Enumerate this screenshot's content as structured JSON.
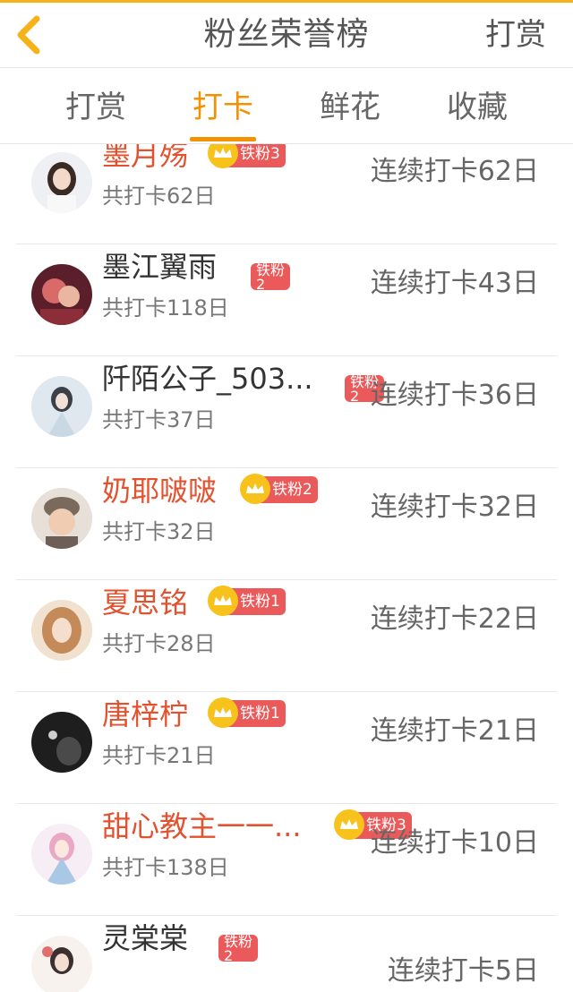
{
  "header": {
    "title": "粉丝荣誉榜",
    "reward_label": "打赏"
  },
  "tabs": [
    {
      "label": "打赏",
      "active": false
    },
    {
      "label": "打卡",
      "active": true
    },
    {
      "label": "鲜花",
      "active": false
    },
    {
      "label": "收藏",
      "active": false
    }
  ],
  "colors": {
    "accent": "#f29200",
    "vip_name": "#e2522f",
    "badge": "#ea5a5a",
    "crown": "#f6c21b"
  },
  "rows": [
    {
      "name": "墨月殇",
      "vip": true,
      "badge": "铁粉3",
      "total": "共打卡62日",
      "streak": "连续打卡62日"
    },
    {
      "name": "墨江翼雨",
      "vip": false,
      "badge": "铁粉\n2",
      "total": "共打卡118日",
      "streak": "连续打卡43日"
    },
    {
      "name": "阡陌公子_503...",
      "vip": false,
      "badge": "铁粉\n2",
      "total": "共打卡37日",
      "streak": "连续打卡36日"
    },
    {
      "name": "奶耶啵啵",
      "vip": true,
      "badge": "铁粉2",
      "total": "共打卡32日",
      "streak": "连续打卡32日"
    },
    {
      "name": "夏思铭",
      "vip": true,
      "badge": "铁粉1",
      "total": "共打卡28日",
      "streak": "连续打卡22日"
    },
    {
      "name": "唐梓柠",
      "vip": true,
      "badge": "铁粉1",
      "total": "共打卡21日",
      "streak": "连续打卡21日"
    },
    {
      "name": "甜心教主一一...",
      "vip": true,
      "badge": "铁粉3",
      "total": "共打卡138日",
      "streak": "连续打卡10日"
    },
    {
      "name": "灵棠棠",
      "vip": false,
      "badge": "铁粉\n2",
      "total": "",
      "streak": "连续打卡5日"
    }
  ]
}
